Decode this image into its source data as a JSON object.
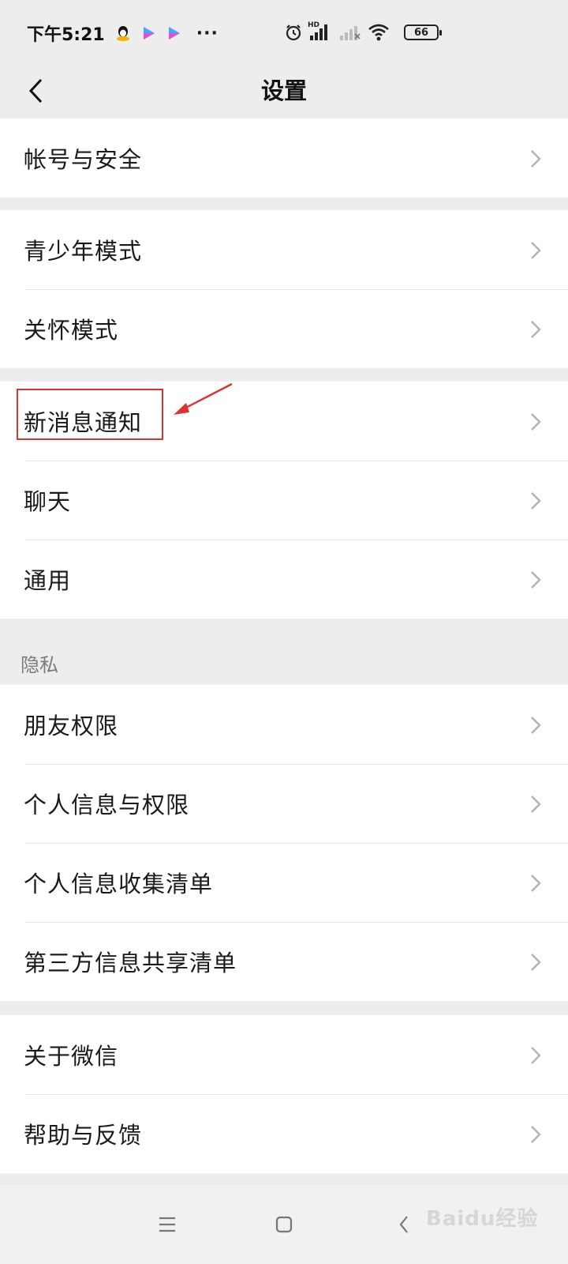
{
  "status_bar": {
    "time": "下午5:21",
    "more_dots": "···",
    "hd_label": "HD",
    "battery_level": "66"
  },
  "header": {
    "title": "设置"
  },
  "groups": [
    {
      "items": [
        {
          "label": "帐号与安全"
        }
      ]
    },
    {
      "items": [
        {
          "label": "青少年模式"
        },
        {
          "label": "关怀模式"
        }
      ]
    },
    {
      "items": [
        {
          "label": "新消息通知"
        },
        {
          "label": "聊天"
        },
        {
          "label": "通用"
        }
      ]
    },
    {
      "header": "隐私",
      "items": [
        {
          "label": "朋友权限"
        },
        {
          "label": "个人信息与权限"
        },
        {
          "label": "个人信息收集清单"
        },
        {
          "label": "第三方信息共享清单"
        }
      ]
    },
    {
      "items": [
        {
          "label": "关于微信"
        },
        {
          "label": "帮助与反馈"
        }
      ]
    }
  ],
  "watermark": "Baidu经验",
  "colors": {
    "highlight": "#e03131",
    "background": "#ededed",
    "row_background": "#ffffff"
  }
}
